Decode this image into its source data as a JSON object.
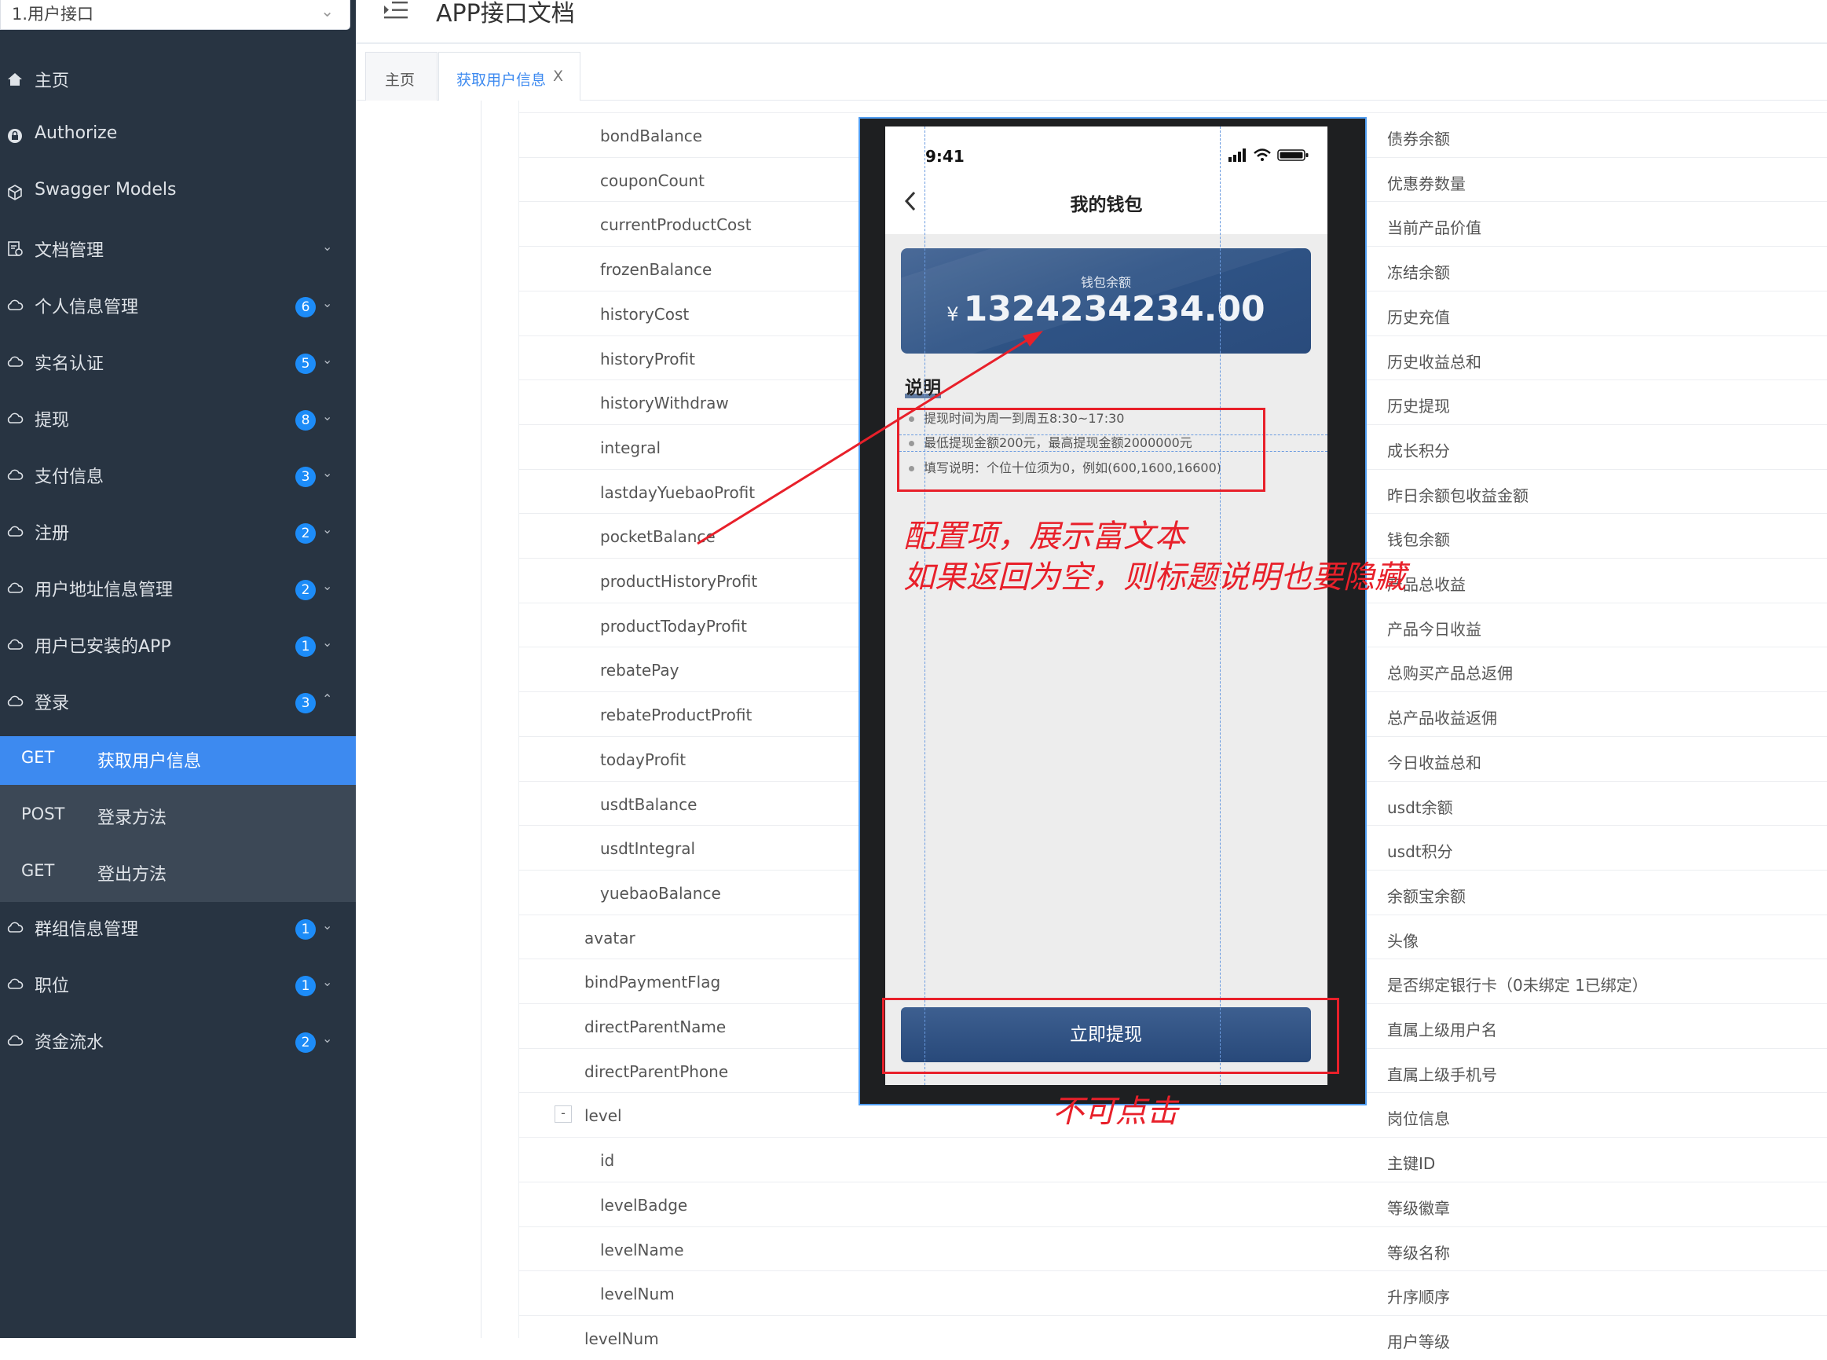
{
  "sidebar": {
    "doc_select": "1.用户接口",
    "items": [
      {
        "label": "主页",
        "icon": "home-icon"
      },
      {
        "label": "Authorize",
        "icon": "lock-icon"
      },
      {
        "label": "Swagger Models",
        "icon": "cube-icon"
      },
      {
        "label": "文档管理",
        "icon": "document-icon"
      },
      {
        "label": "个人信息管理",
        "icon": "cloud-icon",
        "badge": "6"
      },
      {
        "label": "实名认证",
        "icon": "cloud-icon",
        "badge": "5"
      },
      {
        "label": "提现",
        "icon": "cloud-icon",
        "badge": "8"
      },
      {
        "label": "支付信息",
        "icon": "cloud-icon",
        "badge": "3"
      },
      {
        "label": "注册",
        "icon": "cloud-icon",
        "badge": "2"
      },
      {
        "label": "用户地址信息管理",
        "icon": "cloud-icon",
        "badge": "2"
      },
      {
        "label": "用户已安装的APP",
        "icon": "cloud-icon",
        "badge": "1"
      },
      {
        "label": "登录",
        "icon": "cloud-icon",
        "badge": "3"
      },
      {
        "label": "群组信息管理",
        "icon": "cloud-icon",
        "badge": "1"
      },
      {
        "label": "职位",
        "icon": "cloud-icon",
        "badge": "1"
      },
      {
        "label": "资金流水",
        "icon": "cloud-icon",
        "badge": "2"
      }
    ],
    "sub_items": [
      {
        "method": "GET",
        "label": "获取用户信息",
        "active": true
      },
      {
        "method": "POST",
        "label": "登录方法"
      },
      {
        "method": "GET",
        "label": "登出方法"
      }
    ]
  },
  "header": {
    "title": "APP接口文档"
  },
  "tabs": [
    {
      "label": "主页"
    },
    {
      "label": "获取用户信息",
      "close": "X"
    }
  ],
  "rows": [
    {
      "name": "bondBalance",
      "desc": "债券余额"
    },
    {
      "name": "couponCount",
      "desc": "优惠券数量"
    },
    {
      "name": "currentProductCost",
      "desc": "当前产品价值"
    },
    {
      "name": "frozenBalance",
      "desc": "冻结余额"
    },
    {
      "name": "historyCost",
      "desc": "历史充值"
    },
    {
      "name": "historyProfit",
      "desc": "历史收益总和"
    },
    {
      "name": "historyWithdraw",
      "desc": "历史提现"
    },
    {
      "name": "integral",
      "desc": "成长积分"
    },
    {
      "name": "lastdayYuebaoProfit",
      "desc": "昨日余额包收益金额"
    },
    {
      "name": "pocketBalance",
      "desc": "钱包余额"
    },
    {
      "name": "productHistoryProfit",
      "desc": "产品总收益"
    },
    {
      "name": "productTodayProfit",
      "desc": "产品今日收益"
    },
    {
      "name": "rebatePay",
      "desc": "总购买产品总返佣"
    },
    {
      "name": "rebateProductProfit",
      "desc": "总产品收益返佣"
    },
    {
      "name": "todayProfit",
      "desc": "今日收益总和"
    },
    {
      "name": "usdtBalance",
      "desc": "usdt余额"
    },
    {
      "name": "usdtIntegral",
      "desc": "usdt积分"
    },
    {
      "name": "yuebaoBalance",
      "desc": "余额宝余额"
    },
    {
      "name": "avatar",
      "desc": "头像"
    },
    {
      "name": "bindPaymentFlag",
      "desc": "是否绑定银行卡（0未绑定 1已绑定）"
    },
    {
      "name": "directParentName",
      "desc": "直属上级用户名"
    },
    {
      "name": "directParentPhone",
      "desc": "直属上级手机号"
    },
    {
      "name": "level",
      "desc": "岗位信息",
      "expander": "-"
    },
    {
      "name": "id",
      "desc": "主键ID"
    },
    {
      "name": "levelBadge",
      "desc": "等级徽章"
    },
    {
      "name": "levelName",
      "desc": "等级名称"
    },
    {
      "name": "levelNum",
      "desc": "升序顺序"
    },
    {
      "name": "levelNum",
      "desc": "用户等级"
    }
  ],
  "phone": {
    "time": "9:41",
    "nav_title": "我的钱包",
    "wallet_label": "钱包余额",
    "currency": "¥",
    "amount": "1324234234.00",
    "desc_title": "说明",
    "desc_lines": [
      "提现时间为周一到周五8:30~17:30",
      "最低提现金额200元，最高提现金额2000000元",
      "填写说明：个位十位须为0，例如(600,1600,16600)"
    ],
    "button": "立即提现"
  },
  "annotations": {
    "line1": "配置项，展示富文本",
    "line2": "如果返回为空，则标题说明也要隐藏",
    "button_note": "不可点击",
    "color": "#e8202a"
  },
  "colors": {
    "sidebar_bg": "#283442",
    "submenu_bg": "#3c4856",
    "active": "#3d8af0",
    "badge": "#1d8cf8"
  }
}
